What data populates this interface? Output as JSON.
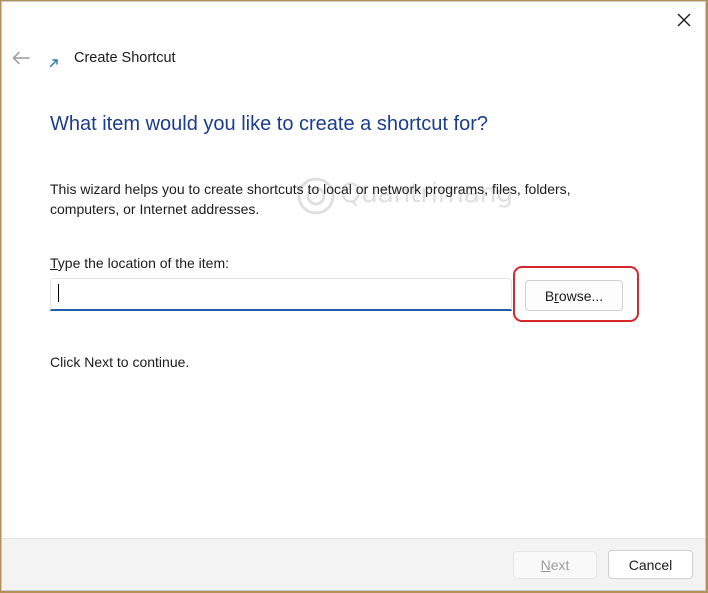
{
  "window": {
    "title": "Create Shortcut",
    "close_glyph": "✕",
    "icons": {
      "back": "arrow-left-icon",
      "app": "shortcut-arrow-icon",
      "close": "close-icon"
    }
  },
  "wizard": {
    "heading": "What item would you like to create a shortcut for?",
    "description": "This wizard helps you to create shortcuts to local or network programs, files, folders, computers, or Internet addresses.",
    "location_label_accel": "T",
    "location_label_rest": "ype the location of the item:",
    "location_value": "",
    "browse_accel": "r",
    "browse_before": "B",
    "browse_after": "owse...",
    "continue_text": "Click Next to continue."
  },
  "footer": {
    "next_accel": "N",
    "next_rest": "ext",
    "cancel_label": "Cancel"
  },
  "watermark": {
    "text": "Quantrimang"
  },
  "colors": {
    "heading": "#1a3d8f",
    "input_underline": "#1f5ea8",
    "highlight_ring": "#d7262c",
    "disabled_text": "#9d9d9d",
    "background_behind_window": "#b58f5a"
  }
}
